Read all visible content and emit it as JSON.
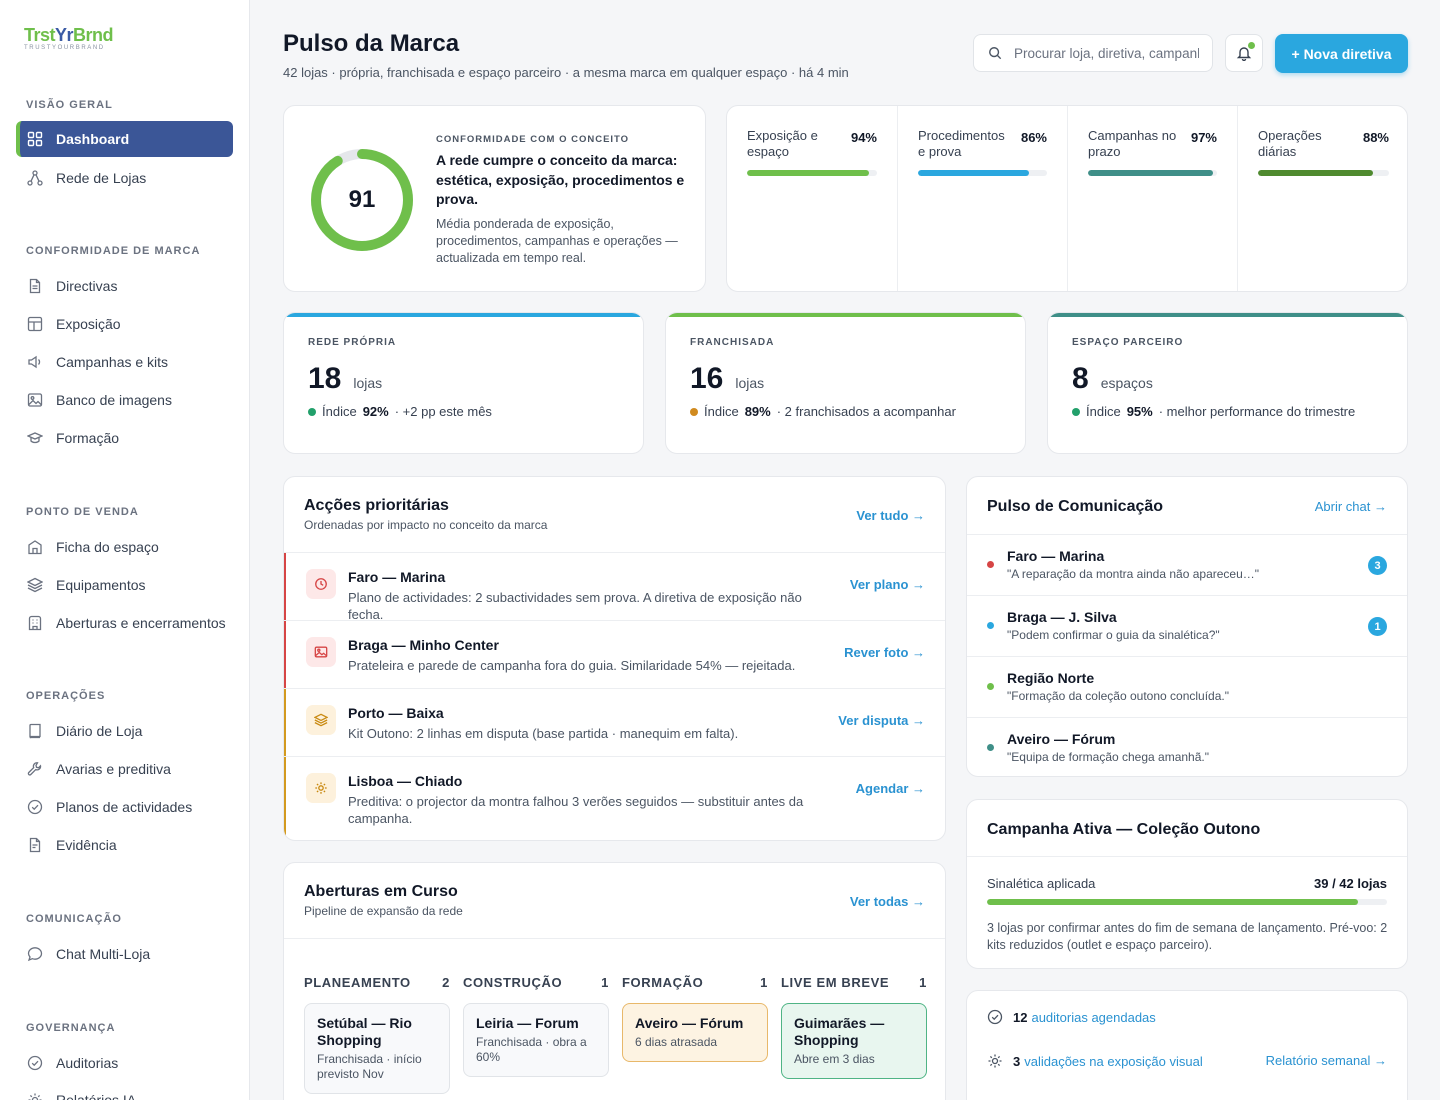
{
  "brand": {
    "part1": "Trst",
    "part2": "Yr",
    "part3": "Brnd",
    "tagline": "TRUSTYOURBRAND"
  },
  "sidebar": {
    "sections": [
      {
        "title": "VISÃO GERAL"
      },
      {
        "title": "CONFORMIDADE DE MARCA"
      },
      {
        "title": "PONTO DE VENDA"
      },
      {
        "title": "OPERAÇÕES"
      },
      {
        "title": "COMUNICAÇÃO"
      },
      {
        "title": "GOVERNANÇA"
      }
    ],
    "items": [
      {
        "label": "Dashboard",
        "icon": "grid-icon",
        "active": true
      },
      {
        "label": "Rede de Lojas",
        "icon": "network-icon"
      },
      {
        "label": "Directivas",
        "icon": "document-icon"
      },
      {
        "label": "Exposição",
        "icon": "layout-icon"
      },
      {
        "label": "Campanhas e kits",
        "icon": "megaphone-icon"
      },
      {
        "label": "Banco de imagens",
        "icon": "image-icon"
      },
      {
        "label": "Formação",
        "icon": "graduation-cap-icon"
      },
      {
        "label": "Ficha do espaço",
        "icon": "store-icon"
      },
      {
        "label": "Equipamentos",
        "icon": "layers-icon"
      },
      {
        "label": "Aberturas e encerramentos",
        "icon": "building-icon"
      },
      {
        "label": "Diário de Loja",
        "icon": "book-icon"
      },
      {
        "label": "Avarias e preditiva",
        "icon": "wrench-icon"
      },
      {
        "label": "Planos de actividades",
        "icon": "check-circle-icon"
      },
      {
        "label": "Evidência",
        "icon": "file-icon"
      },
      {
        "label": "Chat Multi-Loja",
        "icon": "chat-icon"
      },
      {
        "label": "Auditorias",
        "icon": "check-circle-icon"
      },
      {
        "label": "Relatórios IA",
        "icon": "sparkle-icon"
      }
    ]
  },
  "header": {
    "title": "Pulso da Marca",
    "subtitle": "42 lojas · própria, franchisada e espaço parceiro · a mesma marca em qualquer espaço · há 4 min",
    "search_placeholder": "Procurar loja, diretiva, campanha…",
    "new_button": "+ Nova diretiva"
  },
  "score": {
    "value": "91",
    "fraction": 0.91,
    "kicker": "CONFORMIDADE COM O CONCEITO",
    "headline": "A rede cumpre o conceito da marca: estética, exposição, procedimentos e prova.",
    "description": "Média ponderada de exposição, procedimentos, campanhas e operações — actualizada em tempo real."
  },
  "metrics": [
    {
      "label": "Exposição e espaço",
      "value": "94%",
      "fraction": 0.94,
      "color": "#6fbf4b"
    },
    {
      "label": "Procedimentos e prova",
      "value": "86%",
      "fraction": 0.86,
      "color": "#2aa7df"
    },
    {
      "label": "Campanhas no prazo",
      "value": "97%",
      "fraction": 0.97,
      "color": "#3f8f88"
    },
    {
      "label": "Operações diárias",
      "value": "88%",
      "fraction": 0.88,
      "color": "#4f8a2f"
    }
  ],
  "network": [
    {
      "kicker": "REDE PRÓPRIA",
      "count": "18",
      "unit": "lojas",
      "index_label": "Índice",
      "index": "92%",
      "note": "· +2 pp este mês",
      "color": "#2aa7df",
      "dot": "#22a06b"
    },
    {
      "kicker": "FRANCHISADA",
      "count": "16",
      "unit": "lojas",
      "index_label": "Índice",
      "index": "89%",
      "note": "· 2 franchisados a acompanhar",
      "color": "#6fbf4b",
      "dot": "#d08a1f"
    },
    {
      "kicker": "ESPAÇO PARCEIRO",
      "count": "8",
      "unit": "espaços",
      "index_label": "Índice",
      "index": "95%",
      "note": "· melhor performance do trimestre",
      "color": "#3f8f88",
      "dot": "#22a06b"
    }
  ],
  "actions": {
    "title": "Acções prioritárias",
    "subtitle": "Ordenadas por impacto no conceito da marca",
    "link": "Ver tudo →",
    "items": [
      {
        "title": "Faro — Marina",
        "desc": "Plano de actividades: 2 subactividades sem prova. A diretiva de exposição não fecha.",
        "link": "Ver plano →",
        "color": "#d64545",
        "icon": "clock-icon"
      },
      {
        "title": "Braga — Minho Center",
        "desc": "Prateleira e parede de campanha fora do guia. Similaridade 54% — rejeitada.",
        "link": "Rever foto →",
        "color": "#d64545",
        "icon": "image-icon"
      },
      {
        "title": "Porto — Baixa",
        "desc": "Kit Outono: 2 linhas em disputa (base partida · manequim em falta).",
        "link": "Ver disputa →",
        "color": "#d39a1f",
        "icon": "layers-icon"
      },
      {
        "title": "Lisboa — Chiado",
        "desc": "Preditiva: o projector da montra falhou 3 verões seguidos — substituir antes da campanha.",
        "link": "Agendar →",
        "color": "#d39a1f",
        "icon": "sun-icon"
      }
    ]
  },
  "pipeline": {
    "title": "Aberturas em Curso",
    "subtitle": "Pipeline de expansão da rede",
    "link": "Ver todas →",
    "columns": [
      {
        "name": "PLANEAMENTO",
        "count": "2",
        "card": {
          "title": "Setúbal — Rio Shopping",
          "sub": "Franchisada · início previsto Nov"
        }
      },
      {
        "name": "CONSTRUÇÃO",
        "count": "1",
        "card": {
          "title": "Leiria — Forum",
          "sub": "Franchisada · obra a 60%"
        }
      },
      {
        "name": "FORMAÇÃO",
        "count": "1",
        "card": {
          "title": "Aveiro — Fórum",
          "sub": "6 dias atrasada"
        }
      },
      {
        "name": "LIVE EM BREVE",
        "count": "1",
        "card": {
          "title": "Guimarães — Shopping",
          "sub": "Abre em 3 dias"
        }
      }
    ]
  },
  "comms": {
    "title": "Pulso de Comunicação",
    "link": "Abrir chat →",
    "items": [
      {
        "name": "Faro — Marina",
        "msg": "\"A reparação da montra ainda não apareceu…\"",
        "badge": "3",
        "color": "#d64545"
      },
      {
        "name": "Braga — J. Silva",
        "msg": "\"Podem confirmar o guia da sinalética?\"",
        "badge": "1",
        "color": "#2aa7df"
      },
      {
        "name": "Região Norte",
        "msg": "\"Formação da coleção outono concluída.\"",
        "badge": "",
        "color": "#6fbf4b"
      },
      {
        "name": "Aveiro — Fórum",
        "msg": "\"Equipa de formação chega amanhã.\"",
        "badge": "",
        "color": "#3f8f88"
      }
    ]
  },
  "campaign": {
    "title": "Campanha Ativa — Coleção Outono",
    "label": "Sinalética aplicada",
    "value": "39 / 42 lojas",
    "fraction": 0.9286,
    "note": "3 lojas por confirmar antes do fim de semana de lançamento. Pré-voo: 2 kits reduzidos (outlet e espaço parceiro)."
  },
  "summary": {
    "audits_count": "12",
    "audits_label": "auditorias agendadas",
    "validations_count": "3",
    "validations_label": "validações na exposição visual",
    "report_link": "Relatório semanal →"
  }
}
